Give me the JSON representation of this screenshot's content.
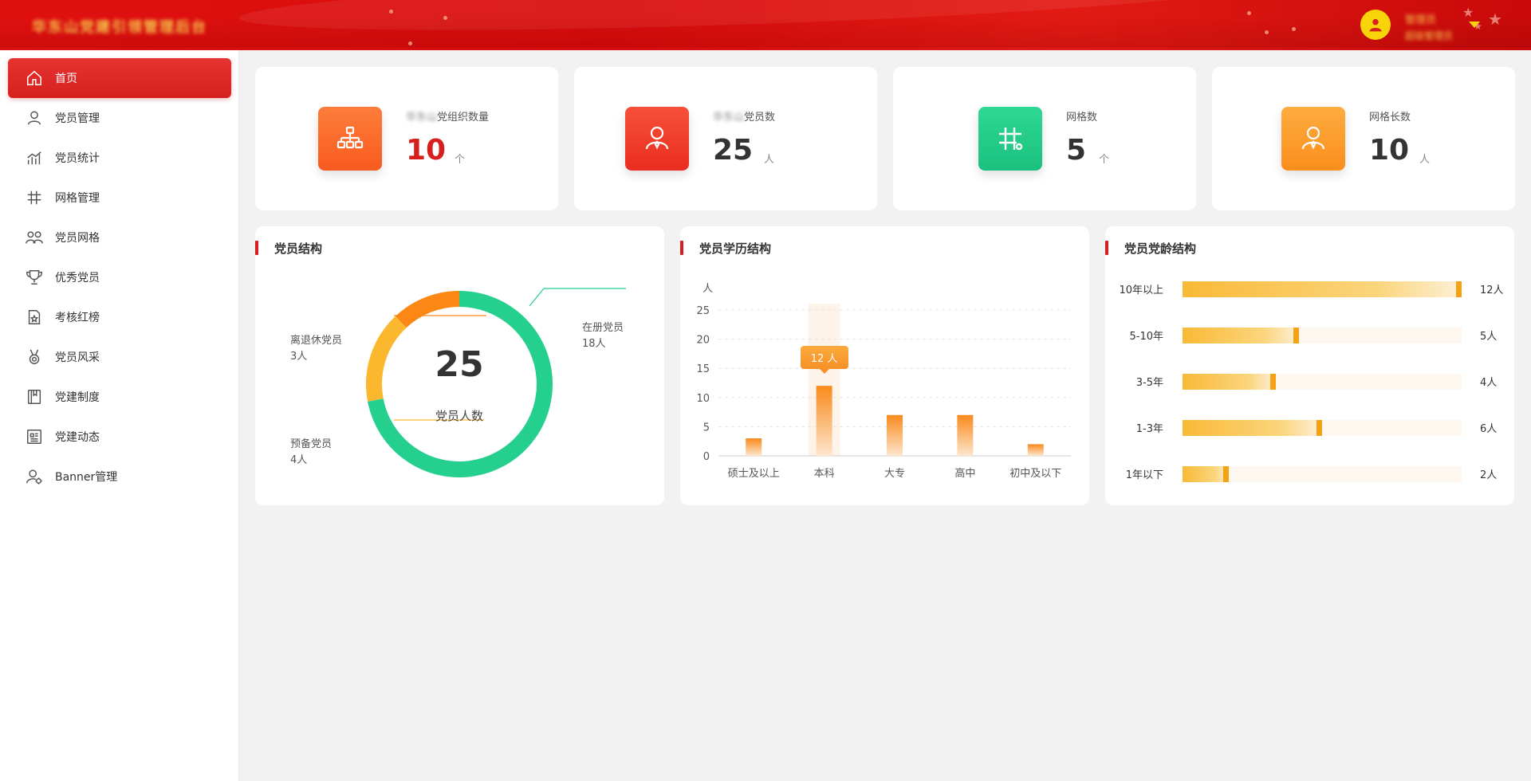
{
  "header": {
    "title": "华东山党建引领管理后台",
    "user_name": "管理员",
    "user_role": "超级管理员"
  },
  "sidebar": {
    "items": [
      {
        "label": "首页",
        "icon": "home-icon",
        "active": true
      },
      {
        "label": "党员管理",
        "icon": "person-icon",
        "active": false
      },
      {
        "label": "党员统计",
        "icon": "chart-icon",
        "active": false
      },
      {
        "label": "网格管理",
        "icon": "grid-icon",
        "active": false
      },
      {
        "label": "党员网格",
        "icon": "people-icon",
        "active": false
      },
      {
        "label": "优秀党员",
        "icon": "trophy-icon",
        "active": false
      },
      {
        "label": "考核红榜",
        "icon": "ranking-icon",
        "active": false
      },
      {
        "label": "党员风采",
        "icon": "medal-icon",
        "active": false
      },
      {
        "label": "党建制度",
        "icon": "book-icon",
        "active": false
      },
      {
        "label": "党建动态",
        "icon": "news-icon",
        "active": false
      },
      {
        "label": "Banner管理",
        "icon": "banner-settings-icon",
        "active": false
      }
    ]
  },
  "stats": [
    {
      "blurred_prefix": "华东山",
      "label": "党组织数量",
      "value": "10",
      "unit": "个",
      "color": "#fd6a2b",
      "value_color": "#d6201e",
      "icon": "org-chart-icon"
    },
    {
      "blurred_prefix": "华东山",
      "label": "党员数",
      "value": "25",
      "unit": "人",
      "color": "#f13c2a",
      "value_color": "#333333",
      "icon": "member-icon"
    },
    {
      "blurred_prefix": "",
      "label": "网格数",
      "value": "5",
      "unit": "个",
      "color": "#21cf8b",
      "value_color": "#333333",
      "icon": "grid-icon"
    },
    {
      "blurred_prefix": "",
      "label": "网格长数",
      "value": "10",
      "unit": "人",
      "color": "#fd9d2c",
      "value_color": "#333333",
      "icon": "leader-icon"
    }
  ],
  "panels": {
    "structure_title": "党员结构",
    "education_title": "党员学历结构",
    "age_title": "党员党龄结构"
  },
  "chart_data": [
    {
      "type": "pie",
      "title": "党员结构",
      "center_value": "25",
      "center_label": "党员人数",
      "slices": [
        {
          "name": "在册党员",
          "value": 18,
          "label": "18人",
          "color": "#25cf8d"
        },
        {
          "name": "预备党员",
          "value": 4,
          "label": "4人",
          "color": "#fbb72d"
        },
        {
          "name": "离退休党员",
          "value": 3,
          "label": "3人",
          "color": "#fb8714"
        }
      ]
    },
    {
      "type": "bar",
      "title": "党员学历结构",
      "ylabel": "人",
      "ylim": [
        0,
        25
      ],
      "yticks": [
        0,
        5,
        10,
        15,
        20,
        25
      ],
      "categories": [
        "硕士及以上",
        "本科",
        "大专",
        "高中",
        "初中及以下"
      ],
      "values": [
        3,
        12,
        7,
        7,
        2
      ],
      "tooltip": {
        "category": "本科",
        "text": "12 人"
      },
      "grid": true
    },
    {
      "type": "bar",
      "orientation": "horizontal",
      "title": "党员党龄结构",
      "max": 12,
      "categories": [
        "10年以上",
        "5-10年",
        "3-5年",
        "1-3年",
        "1年以下"
      ],
      "values": [
        12,
        5,
        4,
        6,
        2
      ],
      "value_labels": [
        "12人",
        "5人",
        "4人",
        "6人",
        "2人"
      ]
    }
  ]
}
